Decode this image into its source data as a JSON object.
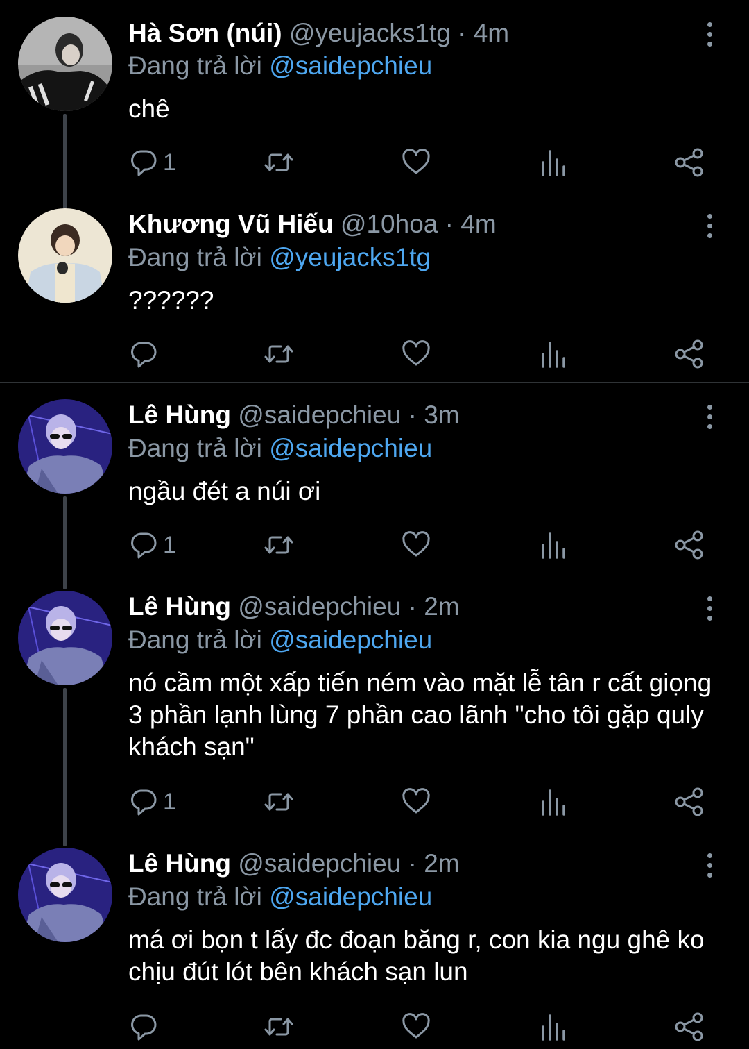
{
  "tweets": [
    {
      "name": "Hà Sơn (núi)",
      "handle": "@yeujacks1tg",
      "dot": "·",
      "time": "4m",
      "reply_prefix": "Đang trả lời ",
      "reply_to": "@saidepchieu",
      "text": "chê",
      "reply_count": "1"
    },
    {
      "name": "Khương Vũ Hiếu",
      "handle": "@10hoa",
      "dot": "·",
      "time": "4m",
      "reply_prefix": "Đang trả lời ",
      "reply_to": "@yeujacks1tg",
      "text": "??????",
      "reply_count": ""
    },
    {
      "name": "Lê Hùng",
      "handle": "@saidepchieu",
      "dot": "·",
      "time": "3m",
      "reply_prefix": "Đang trả lời ",
      "reply_to": "@saidepchieu",
      "text": "ngầu đét a núi ơi",
      "reply_count": "1"
    },
    {
      "name": "Lê Hùng",
      "handle": "@saidepchieu",
      "dot": "·",
      "time": "2m",
      "reply_prefix": "Đang trả lời ",
      "reply_to": "@saidepchieu",
      "text": "nó cầm một xấp tiến ném vào mặt lễ tân r cất giọng 3 phần lạnh lùng 7 phần cao lãnh \"cho tôi gặp quly khách sạn\"",
      "reply_count": "1"
    },
    {
      "name": "Lê Hùng",
      "handle": "@saidepchieu",
      "dot": "·",
      "time": "2m",
      "reply_prefix": "Đang trả lời ",
      "reply_to": "@saidepchieu",
      "text": "má ơi bọn t lấy đc đoạn băng r, con kia ngu ghê ko chịu đút lót bên khách sạn lun",
      "reply_count": ""
    }
  ],
  "colors": {
    "background": "#000000",
    "text": "#ffffff",
    "secondary": "#8b98a5",
    "mention": "#4ea7f0",
    "thread_line": "#3d4249",
    "divider": "#2f3336"
  },
  "icons": [
    "reply-icon",
    "retweet-icon",
    "like-icon",
    "stats-icon",
    "share-icon",
    "more-options-icon"
  ]
}
